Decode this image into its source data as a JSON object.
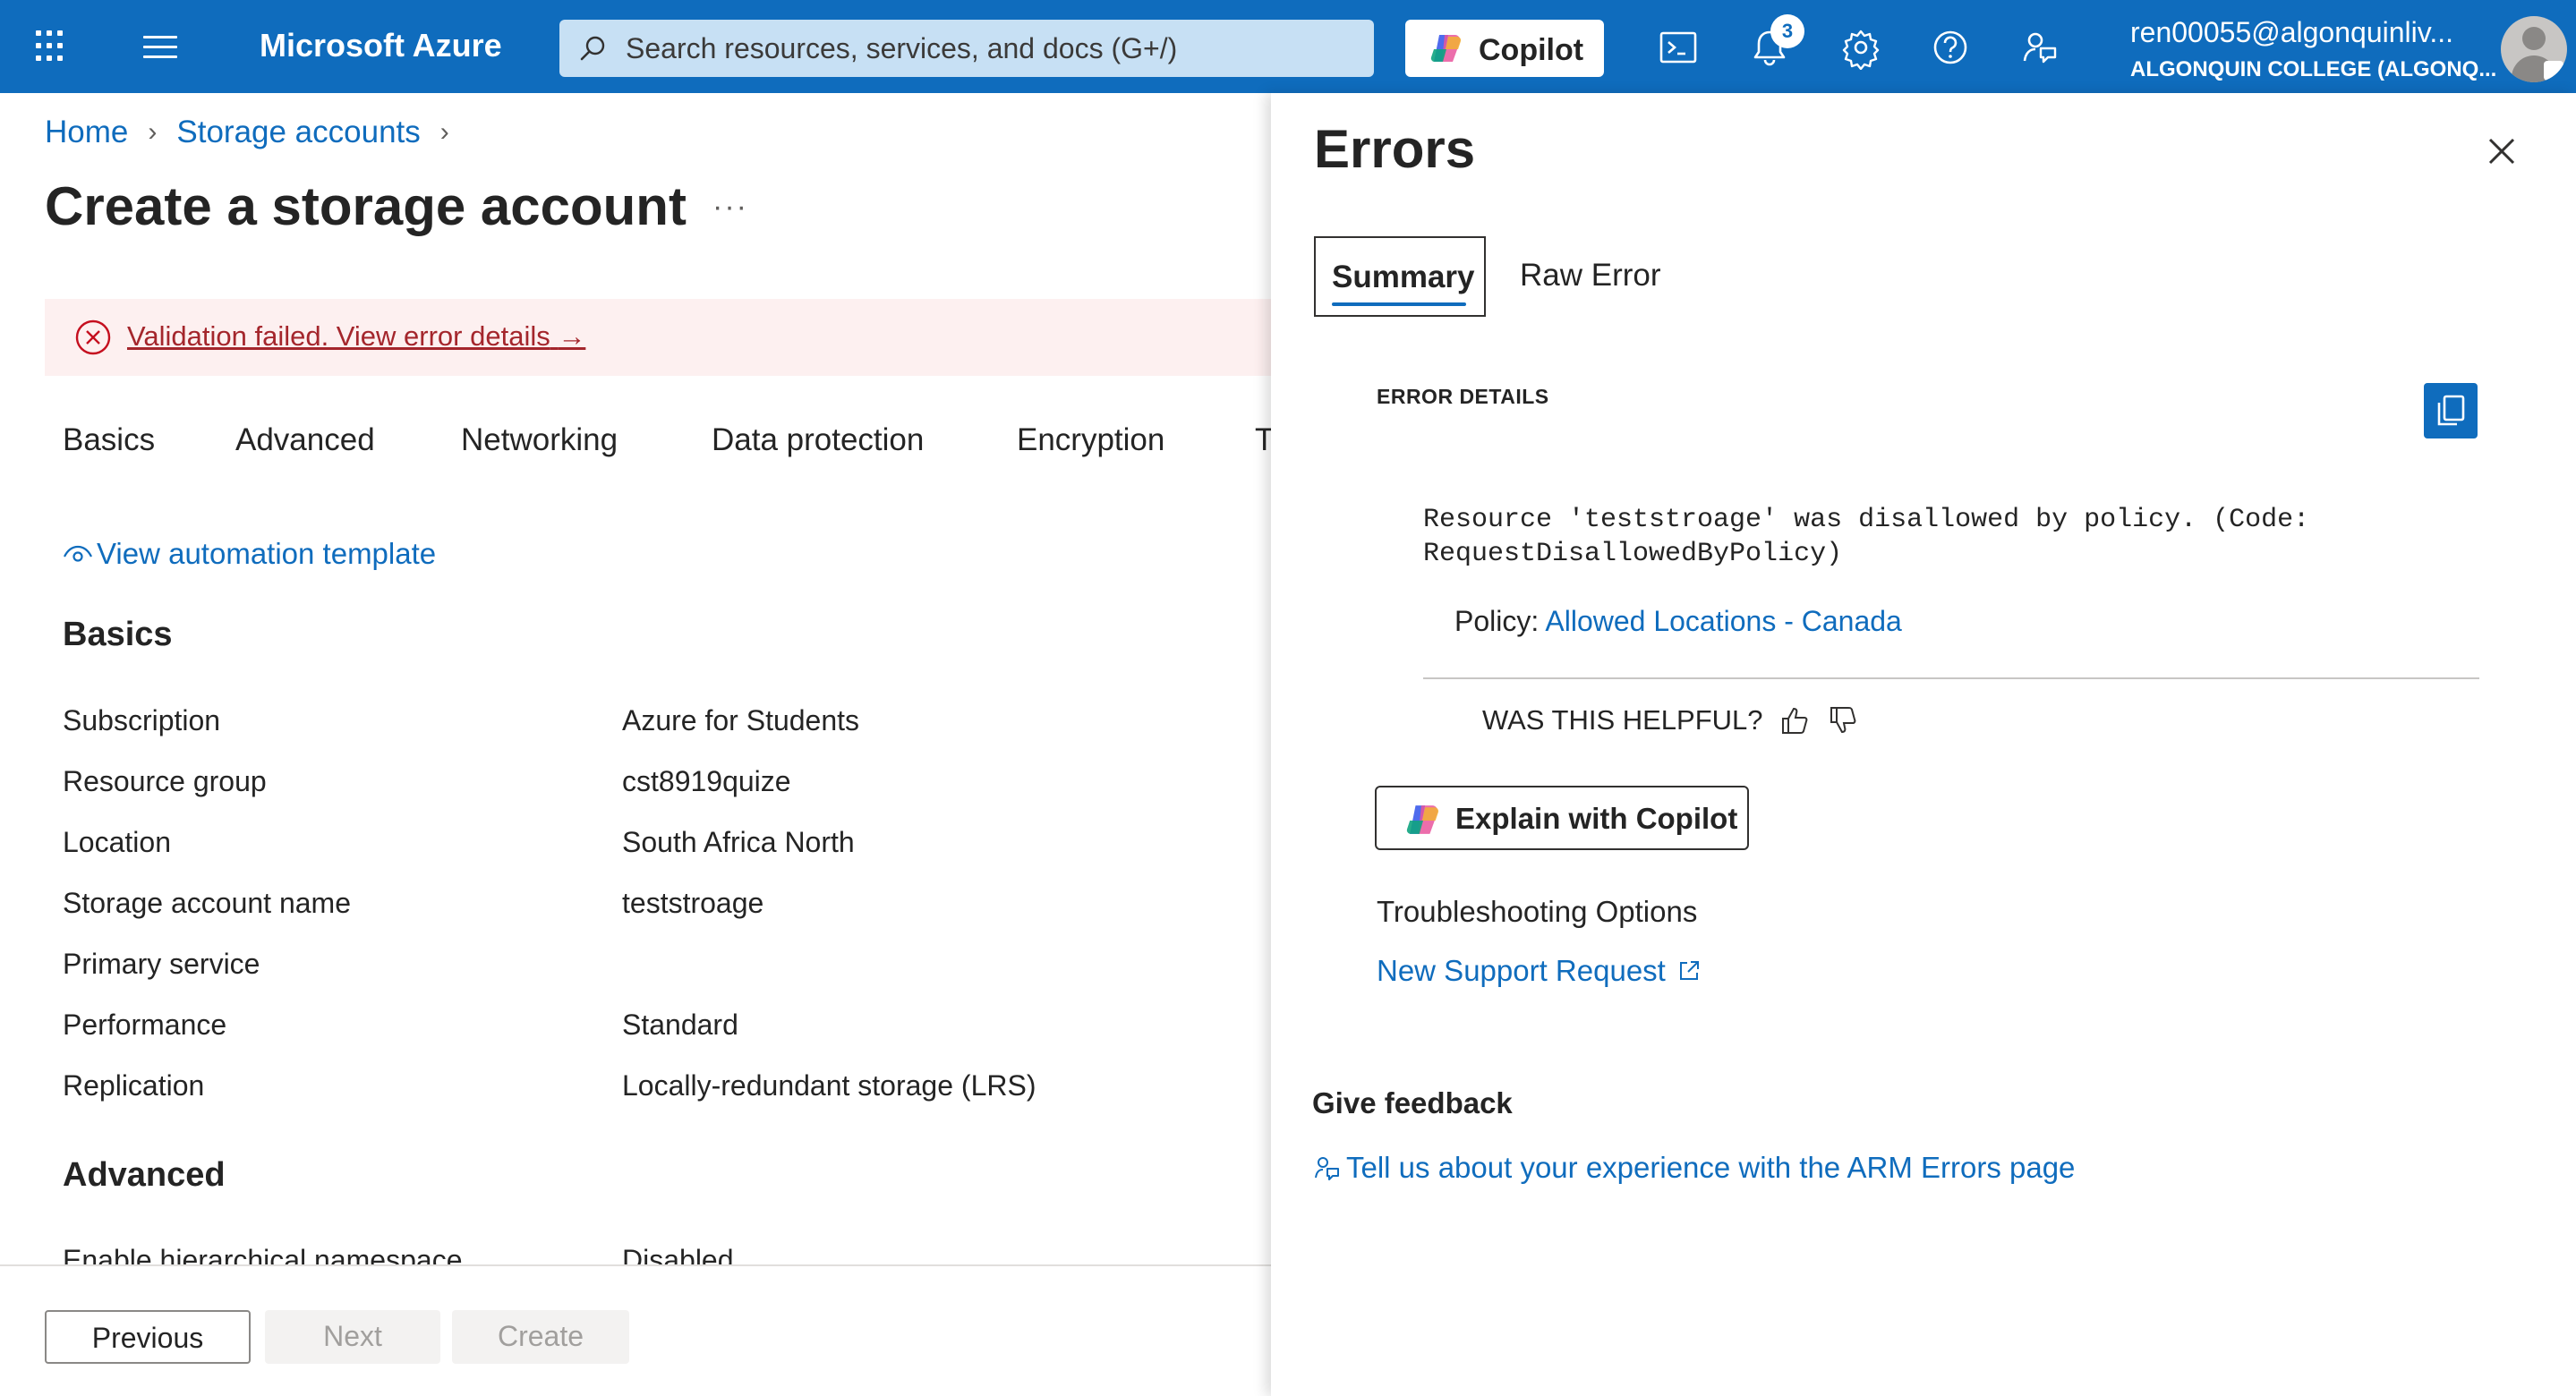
{
  "topbar": {
    "brand": "Microsoft Azure",
    "search_placeholder": "Search resources, services, and docs (G+/)",
    "copilot_label": "Copilot",
    "notification_count": "3",
    "account_name": "ren00055@algonquinliv...",
    "account_org": "ALGONQUIN COLLEGE (ALGONQ...",
    "icons": [
      "waffle-icon",
      "hamburger-icon",
      "search-icon",
      "copilot-icon",
      "cloud-shell-icon",
      "bell-icon",
      "gear-icon",
      "help-icon",
      "feedback-icon",
      "avatar"
    ]
  },
  "breadcrumb": [
    "Home",
    "Storage accounts"
  ],
  "page": {
    "title": "Create a storage account",
    "more": "···",
    "alert_text": "Validation failed. View error details",
    "alert_arrow": "→"
  },
  "tabs": [
    "Basics",
    "Advanced",
    "Networking",
    "Data protection",
    "Encryption",
    "T"
  ],
  "automation_link": "View automation template",
  "sections": {
    "basics": {
      "heading": "Basics",
      "rows": [
        {
          "key": "Subscription",
          "value": "Azure for Students"
        },
        {
          "key": "Resource group",
          "value": "cst8919quize"
        },
        {
          "key": "Location",
          "value": "South Africa North"
        },
        {
          "key": "Storage account name",
          "value": "teststroage"
        },
        {
          "key": "Primary service",
          "value": ""
        },
        {
          "key": "Performance",
          "value": "Standard"
        },
        {
          "key": "Replication",
          "value": "Locally-redundant storage (LRS)"
        }
      ]
    },
    "advanced": {
      "heading": "Advanced",
      "rows": [
        {
          "key": "Enable hierarchical namespace",
          "value": "Disabled"
        }
      ]
    }
  },
  "footer": {
    "previous": "Previous",
    "next": "Next",
    "create": "Create"
  },
  "errors_panel": {
    "title": "Errors",
    "tab_summary": "Summary",
    "tab_raw": "Raw Error",
    "details_heading": "ERROR DETAILS",
    "message": "Resource 'teststroage' was disallowed by policy. (Code:\nRequestDisallowedByPolicy)",
    "policy_label": "Policy: ",
    "policy_link": "Allowed Locations - Canada",
    "helpful_question": "WAS THIS HELPFUL?",
    "explain_button": "Explain with Copilot",
    "troubleshooting_heading": "Troubleshooting Options",
    "support_link": "New Support Request",
    "feedback_heading": "Give feedback",
    "feedback_link": "Tell us about your experience with the ARM Errors page"
  },
  "colors": {
    "topbar": "#0f6cbd",
    "link": "#0f6cbd",
    "alert_bg": "#fdf0f0",
    "error": "#a4262c"
  }
}
